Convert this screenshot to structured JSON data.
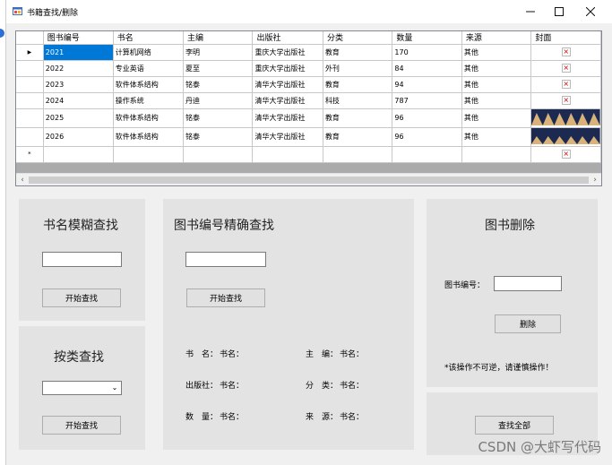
{
  "window": {
    "title": "书籍查找/删除"
  },
  "grid": {
    "columns": [
      "图书编号",
      "书名",
      "主编",
      "出版社",
      "分类",
      "数量",
      "来源",
      "封面"
    ],
    "rows": [
      [
        "2021",
        "计算机网络",
        "李明",
        "重庆大学出版社",
        "教育",
        "170",
        "其他"
      ],
      [
        "2022",
        "专业英语",
        "夏至",
        "重庆大学出版社",
        "外刊",
        "84",
        "其他"
      ],
      [
        "2023",
        "软件体系结构",
        "铭泰",
        "清华大学出版社",
        "教育",
        "94",
        "其他"
      ],
      [
        "2024",
        "操作系统",
        "丹迪",
        "清华大学出版社",
        "科技",
        "787",
        "其他"
      ],
      [
        "2025",
        "软件体系结构",
        "铭泰",
        "清华大学出版社",
        "教育",
        "96",
        "其他"
      ],
      [
        "2026",
        "软件体系结构",
        "铭泰",
        "清华大学出版社",
        "教育",
        "96",
        "其他"
      ]
    ],
    "current_row_marker": "▶",
    "new_row_marker": "*",
    "broken_image_glyph": "×"
  },
  "fuzzy_search": {
    "title": "书名模糊查找",
    "input_value": "",
    "button": "开始查找"
  },
  "category_search": {
    "title": "按类查找",
    "selected": "",
    "button": "开始查找"
  },
  "exact_search": {
    "title": "图书编号精确查找",
    "input_value": "",
    "button": "开始查找",
    "fields": [
      {
        "label": "书　名：",
        "value": "书名："
      },
      {
        "label": "主　编：",
        "value": "书名："
      },
      {
        "label": "出版社：",
        "value": "书名："
      },
      {
        "label": "分　类：",
        "value": "书名："
      },
      {
        "label": "数　量：",
        "value": "书名："
      },
      {
        "label": "来　源：",
        "value": "书名："
      }
    ]
  },
  "delete": {
    "title": "图书删除",
    "id_label": "图书编号：",
    "input_value": "",
    "button": "删除",
    "warning": "*该操作不可逆，请谨慎操作！"
  },
  "find_all": {
    "button": "查找全部"
  },
  "watermark": "CSDN @大虾写代码",
  "colors": {
    "selection": "#0078d7",
    "panel": "#e3e3e3",
    "grid_bg": "#ababab"
  }
}
